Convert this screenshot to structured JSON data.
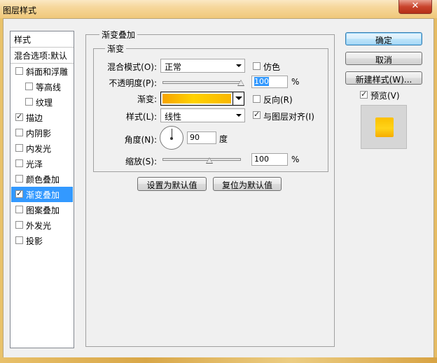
{
  "window": {
    "title": "图层样式",
    "close_label": "✕"
  },
  "styles_panel": {
    "header": "样式",
    "blend_options": "混合选项:默认",
    "items": [
      {
        "label": "斜面和浮雕",
        "checked": false,
        "indent": false
      },
      {
        "label": "等高线",
        "checked": false,
        "indent": true
      },
      {
        "label": "纹理",
        "checked": false,
        "indent": true
      },
      {
        "label": "描边",
        "checked": true,
        "indent": false
      },
      {
        "label": "内阴影",
        "checked": false,
        "indent": false
      },
      {
        "label": "内发光",
        "checked": false,
        "indent": false
      },
      {
        "label": "光泽",
        "checked": false,
        "indent": false
      },
      {
        "label": "颜色叠加",
        "checked": false,
        "indent": false
      },
      {
        "label": "渐变叠加",
        "checked": true,
        "indent": false,
        "selected": true
      },
      {
        "label": "图案叠加",
        "checked": false,
        "indent": false
      },
      {
        "label": "外发光",
        "checked": false,
        "indent": false
      },
      {
        "label": "投影",
        "checked": false,
        "indent": false
      }
    ]
  },
  "gradient_overlay": {
    "group_title": "渐变叠加",
    "subgroup_title": "渐变",
    "blend_mode_label": "混合模式(O):",
    "blend_mode_value": "正常",
    "dither_label": "仿色",
    "dither_checked": false,
    "opacity_label": "不透明度(P):",
    "opacity_value": "100",
    "opacity_percent": 100,
    "percent_unit": "%",
    "gradient_label": "渐变:",
    "gradient_colors": [
      "#f7a400",
      "#ffd200",
      "#f9b800"
    ],
    "reverse_label": "反向(R)",
    "reverse_checked": false,
    "style_label": "样式(L):",
    "style_value": "线性",
    "align_label": "与图层对齐(I)",
    "align_checked": true,
    "angle_label": "角度(N):",
    "angle_value": "90",
    "angle_unit": "度",
    "scale_label": "缩放(S):",
    "scale_value": "100",
    "scale_percent": 100,
    "make_default_label": "设置为默认值",
    "reset_default_label": "复位为默认值"
  },
  "actions": {
    "ok_label": "确定",
    "cancel_label": "取消",
    "new_style_label": "新建样式(W)...",
    "preview_label": "预览(V)",
    "preview_checked": true,
    "preview_color": "#ffc800"
  }
}
